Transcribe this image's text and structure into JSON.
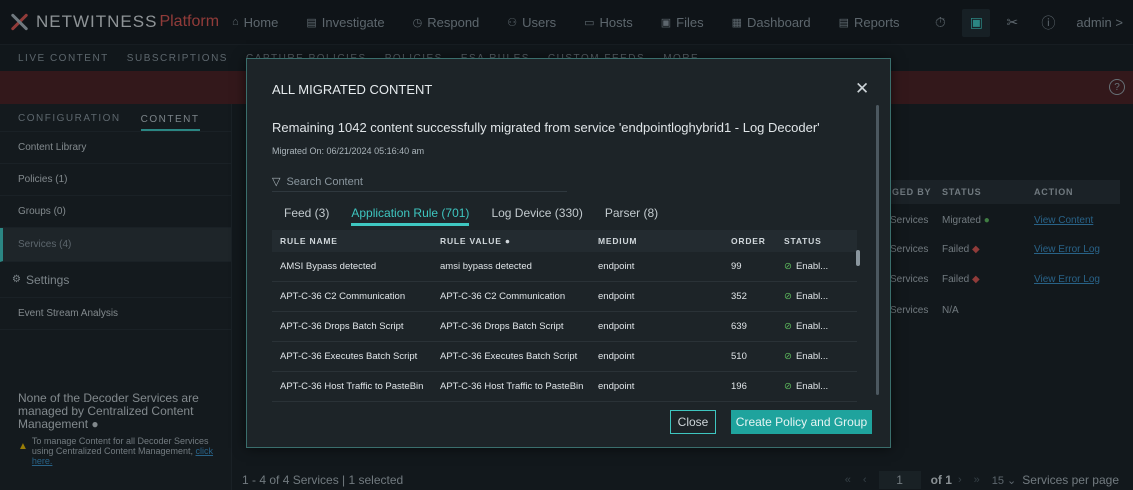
{
  "header": {
    "brand": "NETWITNESS",
    "brand_suffix": "Platform",
    "nav": [
      {
        "icon": "home-icon",
        "glyph": "⌂",
        "label": "Home"
      },
      {
        "icon": "investigate-icon",
        "glyph": "▤",
        "label": "Investigate"
      },
      {
        "icon": "respond-icon",
        "glyph": "◷",
        "label": "Respond"
      },
      {
        "icon": "users-icon",
        "glyph": "⚇",
        "label": "Users"
      },
      {
        "icon": "hosts-icon",
        "glyph": "▭",
        "label": "Hosts"
      },
      {
        "icon": "files-icon",
        "glyph": "▣",
        "label": "Files"
      },
      {
        "icon": "dashboard-icon",
        "glyph": "▦",
        "label": "Dashboard"
      },
      {
        "icon": "reports-icon",
        "glyph": "▤",
        "label": "Reports"
      }
    ],
    "user": "admin >"
  },
  "subbar": {
    "tabs": [
      "LIVE CONTENT",
      "SUBSCRIPTIONS",
      "CAPTURE POLICIES",
      "POLICIES",
      "ESA RULES",
      "CUSTOM FEEDS",
      "MORE"
    ]
  },
  "sidebar": {
    "tabs": [
      "CONFIGURATION",
      "CONTENT"
    ],
    "items": [
      {
        "label": "Content Library"
      },
      {
        "label": "Policies (1)"
      },
      {
        "label": "Groups (0)"
      },
      {
        "label": "Services (4)"
      }
    ],
    "settings_label": "Settings",
    "settings_items": [
      {
        "label": "Event Stream Analysis"
      }
    ],
    "note": "None of the Decoder Services are managed by Centralized Content Management",
    "note_small": "To manage Content for all Decoder Services using Centralized Content Management,",
    "note_link": "click here."
  },
  "services_table": {
    "headers": [
      "GED BY",
      "STATUS",
      "ACTION"
    ],
    "rows": [
      {
        "by": "Services",
        "status": "Migrated",
        "status_icon": "check-circle-icon",
        "action": "View Content"
      },
      {
        "by": "Services",
        "status": "Failed",
        "status_icon": "error-diamond-icon",
        "action": "View Error Log"
      },
      {
        "by": "Services",
        "status": "Failed",
        "status_icon": "error-diamond-icon",
        "action": "View Error Log"
      },
      {
        "by": "Services",
        "status": "N/A",
        "status_icon": "",
        "action": ""
      }
    ]
  },
  "footer": {
    "summary": "1 - 4 of 4 Services | 1 selected",
    "page": "1",
    "of_label": "of 1",
    "per_page": "15",
    "per_page_label": "Services per page"
  },
  "modal": {
    "title": "ALL MIGRATED CONTENT",
    "message": "Remaining 1042 content successfully migrated from service 'endpointloghybrid1 - Log Decoder'",
    "migrated_on": "Migrated On: 06/21/2024 05:16:40 am",
    "search_placeholder": "Search Content",
    "tabs": [
      {
        "label": "Feed (3)"
      },
      {
        "label": "Application Rule (701)"
      },
      {
        "label": "Log Device (330)"
      },
      {
        "label": "Parser (8)"
      }
    ],
    "columns": [
      "RULE NAME",
      "RULE VALUE",
      "MEDIUM",
      "ORDER",
      "STATUS"
    ],
    "rows": [
      {
        "name": "AMSI Bypass detected",
        "value": "amsi bypass detected",
        "medium": "endpoint",
        "order": "99",
        "status": "Enabl..."
      },
      {
        "name": "APT-C-36 C2 Communication",
        "value": "APT-C-36 C2 Communication",
        "medium": "endpoint",
        "order": "352",
        "status": "Enabl..."
      },
      {
        "name": "APT-C-36 Drops Batch Script",
        "value": "APT-C-36 Drops Batch Script",
        "medium": "endpoint",
        "order": "639",
        "status": "Enabl..."
      },
      {
        "name": "APT-C-36 Executes Batch Script",
        "value": "APT-C-36 Executes Batch Script",
        "medium": "endpoint",
        "order": "510",
        "status": "Enabl..."
      },
      {
        "name": "APT-C-36 Host Traffic to PasteBin",
        "value": "APT-C-36 Host Traffic to PasteBin",
        "medium": "endpoint",
        "order": "196",
        "status": "Enabl..."
      }
    ],
    "close_label": "Close",
    "create_label": "Create Policy and Group"
  }
}
